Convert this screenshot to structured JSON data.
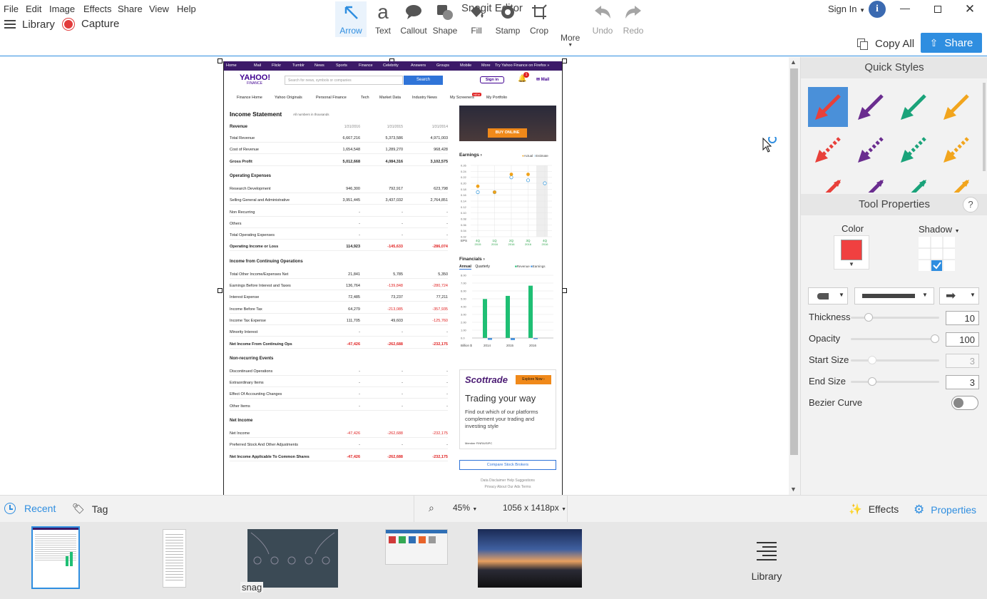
{
  "menu": {
    "items": [
      "File",
      "Edit",
      "Image",
      "Effects",
      "Share",
      "View",
      "Help"
    ],
    "sign_in": "Sign In"
  },
  "app_title": "Snagit Editor",
  "toolbar": {
    "library": "Library",
    "capture": "Capture",
    "tools": [
      "Arrow",
      "Text",
      "Callout",
      "Shape",
      "Fill",
      "Stamp",
      "Crop"
    ],
    "more": "More",
    "undo": "Undo",
    "redo": "Redo",
    "copy_all": "Copy All",
    "share": "Share"
  },
  "doc": {
    "nav": [
      "Home",
      "Mail",
      "Flickr",
      "Tumblr",
      "News",
      "Sports",
      "Finance",
      "Celebrity",
      "Answers",
      "Groups",
      "Mobile",
      "More",
      "Try Yahoo Finance on Firefox »"
    ],
    "logo_top": "YAHOO!",
    "logo_bottom": "FINANCE",
    "search_placeholder": "Search for news, symbols or companies",
    "search_button": "Search",
    "signin": "Sign in",
    "notif_count": "1",
    "mail": "Mail",
    "subnav": [
      "Finance Home",
      "Yahoo Originals",
      "Personal Finance",
      "Tech",
      "Market Data",
      "Industry News",
      "My Screeners",
      "My Portfolio"
    ],
    "new_badge": "NEW",
    "statement_title": "Income Statement",
    "statement_note": "All numbers in thousands",
    "col_dates": [
      "1/31/2016",
      "1/31/2015",
      "1/31/2014"
    ],
    "sections": [
      {
        "title": "Revenue",
        "rows": [
          {
            "label": "Total Revenue",
            "v": [
              "6,667,216",
              "5,373,586",
              "4,971,003"
            ],
            "bold": false,
            "red": [
              false,
              false,
              false
            ]
          },
          {
            "label": "Cost of Revenue",
            "v": [
              "1,654,548",
              "1,289,270",
              "968,428"
            ],
            "bold": false,
            "red": [
              false,
              false,
              false
            ]
          },
          {
            "label": "Gross Profit",
            "v": [
              "5,012,668",
              "4,084,316",
              "3,102,575"
            ],
            "bold": true,
            "red": [
              false,
              false,
              false
            ]
          }
        ]
      },
      {
        "title": "Operating Expenses",
        "rows": [
          {
            "label": "Research Development",
            "v": [
              "946,300",
              "792,917",
              "623,798"
            ],
            "bold": false,
            "red": [
              false,
              false,
              false
            ]
          },
          {
            "label": "Selling General and Administrative",
            "v": [
              "3,951,445",
              "3,437,032",
              "2,764,851"
            ],
            "bold": false,
            "red": [
              false,
              false,
              false
            ]
          },
          {
            "label": "Non Recurring",
            "v": [
              "-",
              "-",
              "-"
            ],
            "bold": false,
            "red": [
              false,
              false,
              false
            ]
          },
          {
            "label": "Others",
            "v": [
              "-",
              "-",
              "-"
            ],
            "bold": false,
            "red": [
              false,
              false,
              false
            ]
          },
          {
            "label": "Total Operating Expenses",
            "v": [
              "-",
              "-",
              "-"
            ],
            "bold": false,
            "red": [
              false,
              false,
              false
            ]
          },
          {
            "label": "Operating Income or Loss",
            "v": [
              "114,923",
              "-145,633",
              "-286,074"
            ],
            "bold": true,
            "red": [
              false,
              true,
              true
            ]
          }
        ]
      },
      {
        "title": "Income from Continuing Operations",
        "rows": [
          {
            "label": "Total Other Income/Expenses Net",
            "v": [
              "21,841",
              "5,785",
              "5,350"
            ],
            "bold": false,
            "red": [
              false,
              false,
              false
            ]
          },
          {
            "label": "Earnings Before Interest and Taxes",
            "v": [
              "136,764",
              "-139,848",
              "-280,724"
            ],
            "bold": false,
            "red": [
              false,
              true,
              true
            ]
          },
          {
            "label": "Interest Expense",
            "v": [
              "72,485",
              "73,237",
              "77,211"
            ],
            "bold": false,
            "red": [
              false,
              false,
              false
            ]
          },
          {
            "label": "Income Before Tax",
            "v": [
              "64,279",
              "-213,085",
              "-357,935"
            ],
            "bold": false,
            "red": [
              false,
              true,
              true
            ]
          },
          {
            "label": "Income Tax Expense",
            "v": [
              "111,705",
              "49,603",
              "-125,760"
            ],
            "bold": false,
            "red": [
              false,
              false,
              true
            ]
          },
          {
            "label": "Minority Interest",
            "v": [
              "-",
              "-",
              "-"
            ],
            "bold": false,
            "red": [
              false,
              false,
              false
            ]
          },
          {
            "label": "Net Income From Continuing Ops",
            "v": [
              "-47,426",
              "-262,688",
              "-232,175"
            ],
            "bold": true,
            "red": [
              true,
              true,
              true
            ]
          }
        ]
      },
      {
        "title": "Non-recurring Events",
        "rows": [
          {
            "label": "Discontinued Operations",
            "v": [
              "-",
              "-",
              "-"
            ],
            "bold": false,
            "red": [
              false,
              false,
              false
            ]
          },
          {
            "label": "Extraordinary Items",
            "v": [
              "-",
              "-",
              "-"
            ],
            "bold": false,
            "red": [
              false,
              false,
              false
            ]
          },
          {
            "label": "Effect Of Accounting Changes",
            "v": [
              "-",
              "-",
              "-"
            ],
            "bold": false,
            "red": [
              false,
              false,
              false
            ]
          },
          {
            "label": "Other Items",
            "v": [
              "-",
              "-",
              "-"
            ],
            "bold": false,
            "red": [
              false,
              false,
              false
            ]
          }
        ]
      },
      {
        "title": "Net Income",
        "rows": [
          {
            "label": "Net Income",
            "v": [
              "-47,426",
              "-262,688",
              "-232,175"
            ],
            "bold": false,
            "red": [
              true,
              true,
              true
            ]
          },
          {
            "label": "Preferred Stock And Other Adjustments",
            "v": [
              "-",
              "-",
              "-"
            ],
            "bold": false,
            "red": [
              false,
              false,
              false
            ]
          },
          {
            "label": "Net Income Applicable To Common Shares",
            "v": [
              "-47,426",
              "-262,688",
              "-232,175"
            ],
            "bold": true,
            "red": [
              true,
              true,
              true
            ]
          }
        ]
      }
    ],
    "ad_buy": "BUY ONLINE",
    "earnings_title": "Earnings ›",
    "earnings_legend": [
      "Actual",
      "Estimate"
    ],
    "eps_label": "EPS",
    "eps_quarters": [
      "4Q 2015",
      "1Q 2016",
      "2Q 2016",
      "3Q 2016",
      "4Q 2016"
    ],
    "eps_ticks": [
      "0.26",
      "0.24",
      "0.22",
      "0.20",
      "0.18",
      "0.16",
      "0.14",
      "0.12",
      "0.10",
      "0.08",
      "0.06",
      "0.04",
      "0.02"
    ],
    "financials_title": "Financials ›",
    "fin_tabs": [
      "Annual",
      "Quarterly"
    ],
    "fin_legend": [
      "Revenue",
      "Earnings"
    ],
    "fin_unit": "Billion $",
    "fin_years": [
      "2014",
      "2015",
      "2016"
    ],
    "fin_ticks": [
      "8.00",
      "7.00",
      "6.00",
      "5.00",
      "4.00",
      "3.00",
      "2.00",
      "1.00",
      "0.0"
    ],
    "scottrade": "Scottrade",
    "scottrade_cta": "Explore Now ›",
    "scottrade_head": "Trading your way",
    "scottrade_body": "Find out which of our platforms complement your trading and investing style",
    "scottrade_member": "Member FINRA/SIPC",
    "compare_btn": "Compare Stock Brokers",
    "footer1": "Data Disclaimer  Help  Suggestions",
    "footer2": "Privacy  About Our Ads  Terms"
  },
  "panel": {
    "quick_styles": "Quick Styles",
    "arrow_colors": [
      "#e8403a",
      "#6a2d8f",
      "#1aa37a",
      "#f2a51d"
    ],
    "tool_properties": "Tool Properties",
    "help": "?",
    "color_label": "Color",
    "color_value": "#f04040",
    "shadow_label": "Shadow",
    "thickness_label": "Thickness",
    "thickness": "10",
    "opacity_label": "Opacity",
    "opacity": "100",
    "start_size_label": "Start Size",
    "start_size": "3",
    "end_size_label": "End Size",
    "end_size": "3",
    "bezier_label": "Bezier Curve"
  },
  "status": {
    "recent": "Recent",
    "tag": "Tag",
    "zoom": "45%",
    "dimensions": "1056 x 1418px",
    "effects": "Effects",
    "properties": "Properties"
  },
  "tray": {
    "snag_label": "snag",
    "library": "Library"
  },
  "chart_data": [
    {
      "type": "scatter",
      "title": "Earnings",
      "categories": [
        "4Q 2015",
        "1Q 2016",
        "2Q 2016",
        "3Q 2016",
        "4Q 2016"
      ],
      "series": [
        {
          "name": "Actual",
          "values": [
            0.19,
            0.17,
            0.23,
            0.23,
            null
          ]
        },
        {
          "name": "Estimate",
          "values": [
            0.17,
            0.17,
            0.22,
            0.21,
            0.2
          ]
        }
      ],
      "ylim": [
        0.02,
        0.26
      ]
    },
    {
      "type": "bar",
      "title": "Financials",
      "categories": [
        "2014",
        "2015",
        "2016"
      ],
      "series": [
        {
          "name": "Revenue",
          "values": [
            4.97,
            5.37,
            6.67
          ]
        },
        {
          "name": "Earnings",
          "values": [
            -0.23,
            -0.26,
            -0.05
          ]
        }
      ],
      "ylabel": "Billion $",
      "ylim": [
        0,
        8
      ]
    }
  ]
}
